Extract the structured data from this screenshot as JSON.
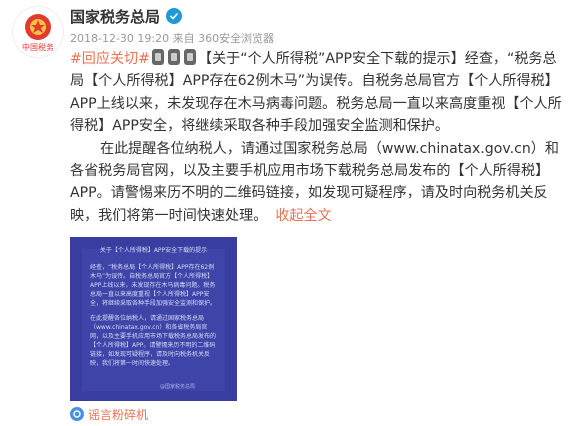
{
  "user": {
    "name": "国家税务总局",
    "avatar_text": "中国税务",
    "verified": true
  },
  "post": {
    "timestamp": "2018-12-30 19:20",
    "source_prefix": "来自",
    "client": "360安全浏览器",
    "hashtag": "#回应关切#",
    "lines": {
      "p1": "【关于“个人所得税”APP安全下载的提示】经查，“税务总局【个人所得税】APP存在62例木马”为误传。自税务总局官方【个人所得税】APP上线以来，未发现存在木马病毒问题。税务总局一直以来高度重视【个人所得税】APP安全，将继续采取各种手段加强安全监测和保护。",
      "p2a": "在此提醒各位纳税人，请通过国家税务总局（",
      "url": "www.chinatax.gov.cn",
      "p2b": "）和各省税务局官网，以及主要手机应用市场下载税务总局发布的【个人所得税】APP。请警惕来历不明的二维码链接，如发现可疑程序，请及时向税务机关反映，我们将第一时间快速处理。",
      "expand": "收起全文"
    }
  },
  "attachment": {
    "title": "关于【个人所得税】APP安全下载的提示",
    "para1": "经查，“税务总局【个人所得税】APP存在62例木马”为误传。自税务总局官方【个人所得税】APP上线以来，未发现存在木马病毒问题。税务总局一直以来高度重视【个人所得税】APP安全，将继续采取各种手段加强安全监测和保护。",
    "para2": "在此提醒各位纳税人，请通过国家税务总局（www.chinatax.gov.cn）和各省税务局官网，以及主要手机应用市场下载税务总局发布的【个人所得税】APP。请警惕来历不明的二维码链接，如发现可疑程序，请及时向税务机关反映，我们将第一时间快速处理。",
    "footer": "@国家税务总局"
  },
  "footer": {
    "source_link": "谣言粉碎机"
  },
  "colors": {
    "accent": "#eb7350",
    "attachment_bg": "#383d9f",
    "verified": "#1e9bd7"
  }
}
